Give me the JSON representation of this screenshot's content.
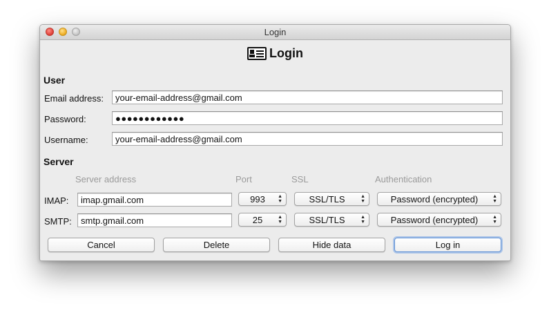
{
  "window": {
    "title": "Login"
  },
  "header": {
    "icon": "id-card-icon",
    "title": "Login"
  },
  "user": {
    "section_label": "User",
    "email_label": "Email address:",
    "email_value": "your-email-address@gmail.com",
    "password_label": "Password:",
    "password_value": "●●●●●●●●●●●●",
    "username_label": "Username:",
    "username_value": "your-email-address@gmail.com"
  },
  "server": {
    "section_label": "Server",
    "columns": {
      "address": "Server address",
      "port": "Port",
      "ssl": "SSL",
      "auth": "Authentication"
    },
    "imap": {
      "label": "IMAP:",
      "address": "imap.gmail.com",
      "port": "993",
      "ssl": "SSL/TLS",
      "auth": "Password (encrypted)"
    },
    "smtp": {
      "label": "SMTP:",
      "address": "smtp.gmail.com",
      "port": "25",
      "ssl": "SSL/TLS",
      "auth": "Password (encrypted)"
    }
  },
  "buttons": {
    "cancel": "Cancel",
    "delete": "Delete",
    "hide": "Hide data",
    "login": "Log in"
  }
}
